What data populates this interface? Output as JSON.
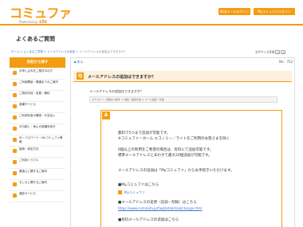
{
  "header": {
    "logo_text": "コミュファ",
    "logo_sub": "Powered by",
    "logo_brand": "ctc",
    "btn_mail": "Webメールログイン",
    "btn_my": "Myコミュファログイン"
  },
  "page": {
    "title": "よくあるご質問",
    "breadcrumb_prefix": "ホーム > よくあるご質問 > メールアドレスの追加 > ",
    "breadcrumb_current": "メールアドレスの追加はできますか？",
    "font_size_label": "文字サイズ変更",
    "font_small": "小",
    "font_large": "大"
  },
  "sidebar": {
    "title": "目的から探す",
    "items": [
      "お申し込みをご検討中の方",
      "ご利用開始・開通までのご案内",
      "ご契約内容・変更・解約",
      "各種サービス",
      "ご利用料金の確認・お支払い",
      "お引越し・休止の各種手続き",
      "ID・パスワード・Myコミュファ情報",
      "接続・設定方法",
      "ご利用トラブル",
      "乗換えに関するご案内",
      "もしもに関するご案内",
      "通信サービス"
    ]
  },
  "content": {
    "back": "戻る",
    "no_label": "No：",
    "no_value": "752",
    "question": "メールアドレスの追加はできますか？",
    "question_sub": "メールアドレスの追加はできますか？",
    "category": "カテゴリー：目的から探す ＞ 接続・設定方法 ＞ メール設定・仕様",
    "answer_lines": [
      "無料で5つまで追加が可能です。",
      "※コミュファ・ホーム エコノミー／ライトをご利用のお客さまを除く",
      "",
      "6個以上の利用をご希望の場合は、有料にて追加可能です。",
      "標準メールアドレスとあわせて最大20個追加が可能です。",
      "",
      "メールアドレスの追加は「Myコミュファ」からお手続きいただけます。"
    ],
    "my_label": "■Myコミュファはこちら",
    "my_link": "Myコミュファ",
    "change_label": "■メールアドレスの変更（追加・削除）はこちら",
    "change_url": "https://www.commufa.jp/faq/detail/mail/change.html",
    "paid_label": "■有料メールアドレスの追加はこちら"
  },
  "colors": {
    "accent": "#f39c12",
    "link": "#3a7bd5"
  }
}
